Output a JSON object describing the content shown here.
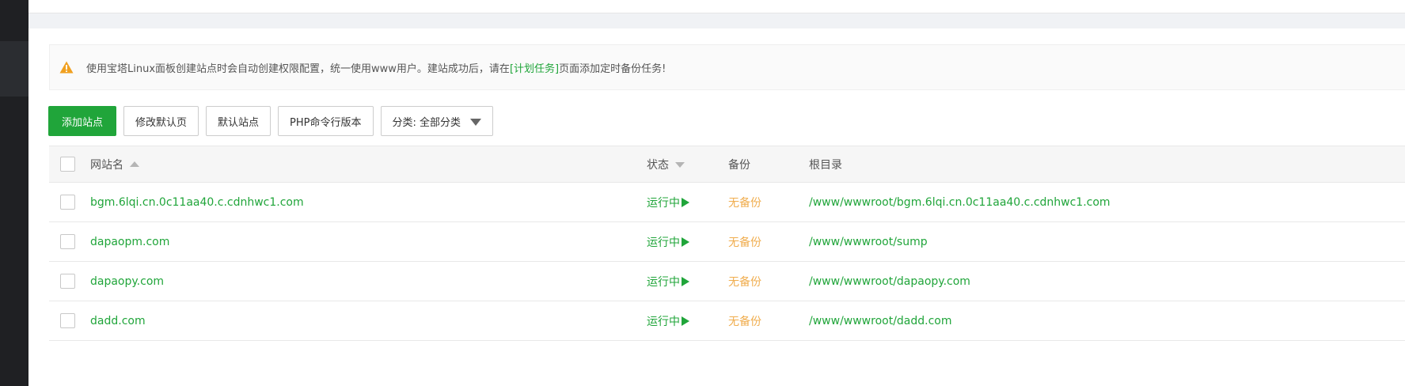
{
  "notice": {
    "icon": "warning-triangle-icon",
    "text_before": "使用宝塔Linux面板创建站点时会自动创建权限配置，统一使用www用户。建站成功后，请在",
    "link": "[计划任务]",
    "text_after": "页面添加定时备份任务!"
  },
  "toolbar": {
    "add_site": "添加站点",
    "modify_default_page": "修改默认页",
    "default_site": "默认站点",
    "php_cli_version": "PHP命令行版本",
    "category": "分类: 全部分类"
  },
  "table": {
    "headers": {
      "name": "网站名",
      "status": "状态",
      "backup": "备份",
      "root": "根目录"
    },
    "rows": [
      {
        "name": "bgm.6lqi.cn.0c11aa40.c.cdnhwc1.com",
        "status": "运行中",
        "backup": "无备份",
        "root": "/www/wwwroot/bgm.6lqi.cn.0c11aa40.c.cdnhwc1.com"
      },
      {
        "name": "dapaopm.com",
        "status": "运行中",
        "backup": "无备份",
        "root": "/www/wwwroot/sump"
      },
      {
        "name": "dapaopy.com",
        "status": "运行中",
        "backup": "无备份",
        "root": "/www/wwwroot/dapaopy.com"
      },
      {
        "name": "dadd.com",
        "status": "运行中",
        "backup": "无备份",
        "root": "/www/wwwroot/dadd.com"
      }
    ]
  },
  "colors": {
    "accent": "#20a53a",
    "warning": "#f0ad4e"
  }
}
